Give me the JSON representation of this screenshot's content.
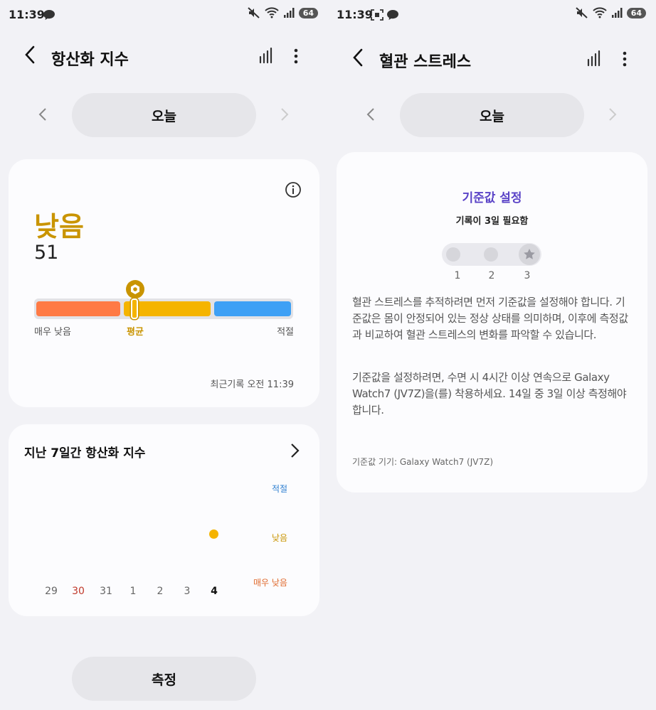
{
  "left": {
    "status": {
      "time": "11:39",
      "battery": "64"
    },
    "title": "항산화 지수",
    "date_pill": "오늘",
    "card1": {
      "level": "낮음",
      "value": "51",
      "gauge_labels": {
        "low": "매우 낮음",
        "mid": "평균",
        "high": "적절"
      },
      "recent": "최근기록 오전 11:39"
    },
    "card2": {
      "title": "지난 7일간 항산화 지수",
      "levels": {
        "top": "적절",
        "mid": "낮음",
        "bottom": "매우 낮음"
      },
      "days": [
        "29",
        "30",
        "31",
        "1",
        "2",
        "3",
        "4"
      ]
    },
    "measure_button": "측정"
  },
  "right": {
    "status": {
      "time": "11:39",
      "battery": "64"
    },
    "title": "혈관 스트레스",
    "date_pill": "오늘",
    "card": {
      "heading": "기준값 설정",
      "subheading": "기록이 3일 필요함",
      "steps": [
        "1",
        "2",
        "3"
      ],
      "para1": "혈관 스트레스를 추적하려면 먼저 기준값을 설정해야 합니다. 기준값은 몸이 안정되어 있는 정상 상태를 의미하며, 이후에 측정값과 비교하여 혈관 스트레스의 변화를 파악할 수 있습니다.",
      "para2": "기준값을 설정하려면, 수면 시 4시간 이상 연속으로 Galaxy Watch7 (JV7Z)을(를) 착용하세요. 14일 중 3일 이상 측정해야 합니다.",
      "device": "기준값 기기: Galaxy Watch7 (JV7Z)"
    }
  },
  "colors": {
    "orange": "#ff7a45",
    "yellow": "#f5b400",
    "blue": "#3ea0f5",
    "gold": "#c99400",
    "purple": "#5a43c7",
    "red_day": "#c0392b"
  }
}
